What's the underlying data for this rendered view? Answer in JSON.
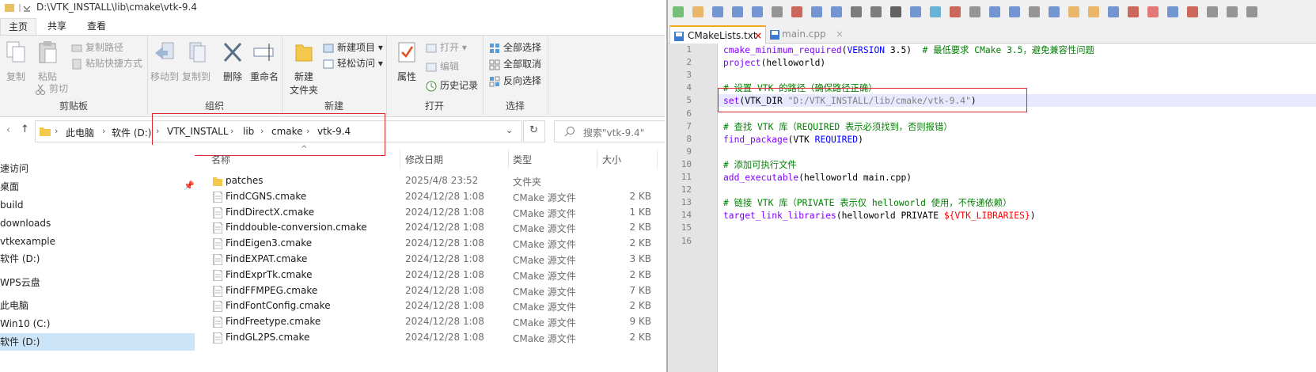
{
  "explorer": {
    "title": "D:\\VTK_INSTALL\\lib\\cmake\\vtk-9.4",
    "ribbon_tabs": [
      "主页",
      "共享",
      "查看"
    ],
    "clipboard": {
      "copy": "复制",
      "paste": "粘贴",
      "copy_path": "复制路径",
      "paste_shortcut": "粘贴快捷方式",
      "cut": "剪切",
      "group": "剪贴板"
    },
    "organize": {
      "move_to": "移动到",
      "copy_to": "复制到",
      "delete": "删除",
      "rename": "重命名",
      "group": "组织"
    },
    "new": {
      "new_folder_line1": "新建",
      "new_folder_line2": "文件夹",
      "new_item": "新建项目",
      "easy_access": "轻松访问",
      "group": "新建"
    },
    "open": {
      "properties": "属性",
      "open": "打开",
      "edit": "编辑",
      "history": "历史记录",
      "group": "打开"
    },
    "select": {
      "select_all": "全部选择",
      "select_none": "全部取消",
      "invert": "反向选择",
      "group": "选择"
    },
    "breadcrumb": [
      "此电脑",
      "软件 (D:)",
      "VTK_INSTALL",
      "lib",
      "cmake",
      "vtk-9.4"
    ],
    "search_placeholder": "搜索\"vtk-9.4\"",
    "nav_items": [
      "速访问",
      "桌面",
      "build",
      "downloads",
      "vtkexample",
      "软件 (D:)",
      "WPS云盘",
      "此电脑",
      "Win10 (C:)",
      "软件 (D:)"
    ],
    "columns": {
      "name": "名称",
      "date": "修改日期",
      "type": "类型",
      "size": "大小"
    },
    "files": [
      {
        "name": "patches",
        "date": "2025/4/8 23:52",
        "type": "文件夹",
        "size": "",
        "icon": "folder-icon"
      },
      {
        "name": "FindCGNS.cmake",
        "date": "2024/12/28 1:08",
        "type": "CMake 源文件",
        "size": "2 KB",
        "icon": "file-icon"
      },
      {
        "name": "FindDirectX.cmake",
        "date": "2024/12/28 1:08",
        "type": "CMake 源文件",
        "size": "1 KB",
        "icon": "file-icon"
      },
      {
        "name": "Finddouble-conversion.cmake",
        "date": "2024/12/28 1:08",
        "type": "CMake 源文件",
        "size": "2 KB",
        "icon": "file-icon"
      },
      {
        "name": "FindEigen3.cmake",
        "date": "2024/12/28 1:08",
        "type": "CMake 源文件",
        "size": "2 KB",
        "icon": "file-icon"
      },
      {
        "name": "FindEXPAT.cmake",
        "date": "2024/12/28 1:08",
        "type": "CMake 源文件",
        "size": "3 KB",
        "icon": "file-icon"
      },
      {
        "name": "FindExprTk.cmake",
        "date": "2024/12/28 1:08",
        "type": "CMake 源文件",
        "size": "2 KB",
        "icon": "file-icon"
      },
      {
        "name": "FindFFMPEG.cmake",
        "date": "2024/12/28 1:08",
        "type": "CMake 源文件",
        "size": "7 KB",
        "icon": "file-icon"
      },
      {
        "name": "FindFontConfig.cmake",
        "date": "2024/12/28 1:08",
        "type": "CMake 源文件",
        "size": "2 KB",
        "icon": "file-icon"
      },
      {
        "name": "FindFreetype.cmake",
        "date": "2024/12/28 1:08",
        "type": "CMake 源文件",
        "size": "9 KB",
        "icon": "file-icon"
      },
      {
        "name": "FindGL2PS.cmake",
        "date": "2024/12/28 1:08",
        "type": "CMake 源文件",
        "size": "2 KB",
        "icon": "file-icon"
      }
    ]
  },
  "notepad": {
    "tabs": [
      "CMakeLists.txt",
      "main.cpp"
    ],
    "active_tab": "CMakeLists.txt",
    "lines": [
      [
        {
          "t": "cmake_minimum_required",
          "c": "fn"
        },
        {
          "t": "(",
          "c": ""
        },
        {
          "t": "VERSION",
          "c": "k"
        },
        {
          "t": " 3.5)  ",
          "c": ""
        },
        {
          "t": "# 最低要求 CMake 3.5，避免兼容性问题",
          "c": "c"
        }
      ],
      [
        {
          "t": "project",
          "c": "fn"
        },
        {
          "t": "(helloworld)",
          "c": ""
        }
      ],
      [],
      [
        {
          "t": "# 设置 VTK 的路径（确保路径正确）",
          "c": "c"
        }
      ],
      [
        {
          "t": "set",
          "c": "fn"
        },
        {
          "t": "(VTK_DIR ",
          "c": ""
        },
        {
          "t": "\"D:/VTK_INSTALL/lib/cmake/vtk-9.4\"",
          "c": "s"
        },
        {
          "t": ")",
          "c": ""
        }
      ],
      [],
      [
        {
          "t": "# 查找 VTK 库（REQUIRED 表示必须找到，否则报错）",
          "c": "c"
        }
      ],
      [
        {
          "t": "find_package",
          "c": "fn"
        },
        {
          "t": "(VTK ",
          "c": ""
        },
        {
          "t": "REQUIRED",
          "c": "k"
        },
        {
          "t": ")",
          "c": ""
        }
      ],
      [],
      [
        {
          "t": "# 添加可执行文件",
          "c": "c"
        }
      ],
      [
        {
          "t": "add_executable",
          "c": "fn"
        },
        {
          "t": "(helloworld main.cpp)",
          "c": ""
        }
      ],
      [],
      [
        {
          "t": "# 链接 VTK 库（PRIVATE 表示仅 helloworld 使用，不传递依赖）",
          "c": "c"
        }
      ],
      [
        {
          "t": "target_link_libraries",
          "c": "fn"
        },
        {
          "t": "(helloworld PRIVATE ",
          "c": ""
        },
        {
          "t": "${VTK_LIBRARIES}",
          "c": "v"
        },
        {
          "t": ")",
          "c": ""
        }
      ],
      [],
      []
    ],
    "line_numbers": [
      "1",
      "2",
      "3",
      "4",
      "5",
      "6",
      "7",
      "8",
      "9",
      "10",
      "11",
      "12",
      "13",
      "14",
      "15",
      "16"
    ]
  },
  "colors": {
    "accent": "#0063b1",
    "highlight_box": "#e0282e",
    "caret_line": "#e8e8ff"
  }
}
